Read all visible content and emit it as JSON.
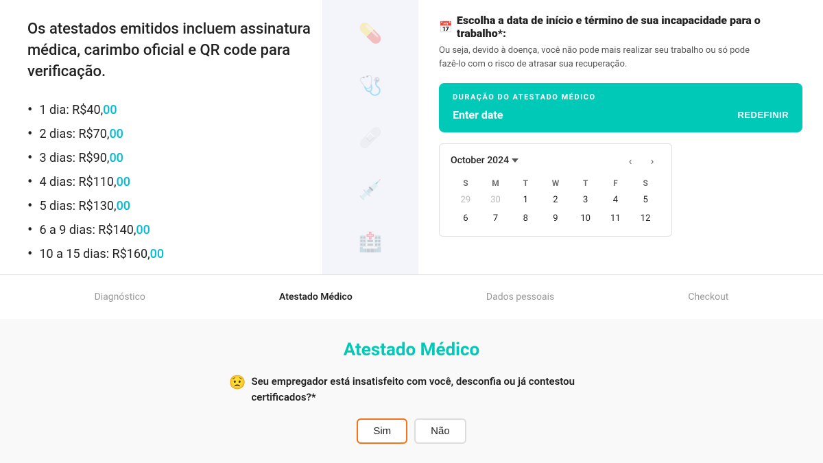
{
  "left": {
    "heading": "Os atestados emitidos incluem assinatura médica, carimbo oficial e QR code para verificação.",
    "prices": [
      {
        "label": "1 dia: R$40,",
        "highlight": "00"
      },
      {
        "label": "2 dias: R$70,",
        "highlight": "00"
      },
      {
        "label": "3 dias: R$90,",
        "highlight": "00"
      },
      {
        "label": "4 dias: R$110,",
        "highlight": "00"
      },
      {
        "label": "5 dias: R$130,",
        "highlight": "00"
      },
      {
        "label": "6 a 9 dias: R$140,",
        "highlight": "00"
      },
      {
        "label": "10 a 15 dias: R$160,",
        "highlight": "00"
      }
    ]
  },
  "right": {
    "calendar_icon": "📅",
    "header": "Escolha a data de início e término de sua incapacidade para o trabalho*:",
    "subtitle": "Ou seja, devido à doença, você não pode mais realizar seu trabalho ou só pode fazê-lo com o risco de atrasar sua recuperação.",
    "duration_label": "DURAÇÃO DO ATESTADO MÉDICO",
    "enter_date": "Enter date",
    "reset_btn": "REDEFINIR",
    "calendar": {
      "month": "October 2024",
      "days_of_week": [
        "S",
        "M",
        "T",
        "W",
        "T",
        "F",
        "S"
      ],
      "weeks": [
        [
          {
            "day": "29",
            "other": true
          },
          {
            "day": "30",
            "other": true
          },
          {
            "day": "1",
            "other": false
          },
          {
            "day": "2",
            "other": false
          },
          {
            "day": "3",
            "other": false
          },
          {
            "day": "4",
            "other": false
          },
          {
            "day": "5",
            "other": false
          }
        ],
        [
          {
            "day": "6",
            "other": false
          },
          {
            "day": "7",
            "other": false
          },
          {
            "day": "8",
            "other": false
          },
          {
            "day": "9",
            "other": false
          },
          {
            "day": "10",
            "other": false
          },
          {
            "day": "11",
            "other": false
          },
          {
            "day": "12",
            "other": false
          }
        ]
      ]
    }
  },
  "bottom_nav": {
    "steps": [
      {
        "label": "Diagnóstico",
        "active": false
      },
      {
        "label": "Atestado\nMédico",
        "active": true
      },
      {
        "label": "Dados pessoais",
        "active": false
      },
      {
        "label": "Checkout",
        "active": false
      }
    ]
  },
  "bottom_section": {
    "title": "Atestado Médico",
    "question_emoji": "😟",
    "question_text": "Seu empregador está insatisfeito com você, desconfia ou já contestou certificados?*",
    "options": [
      {
        "label": "Sim",
        "selected": true
      },
      {
        "label": "Não",
        "selected": false
      }
    ]
  }
}
